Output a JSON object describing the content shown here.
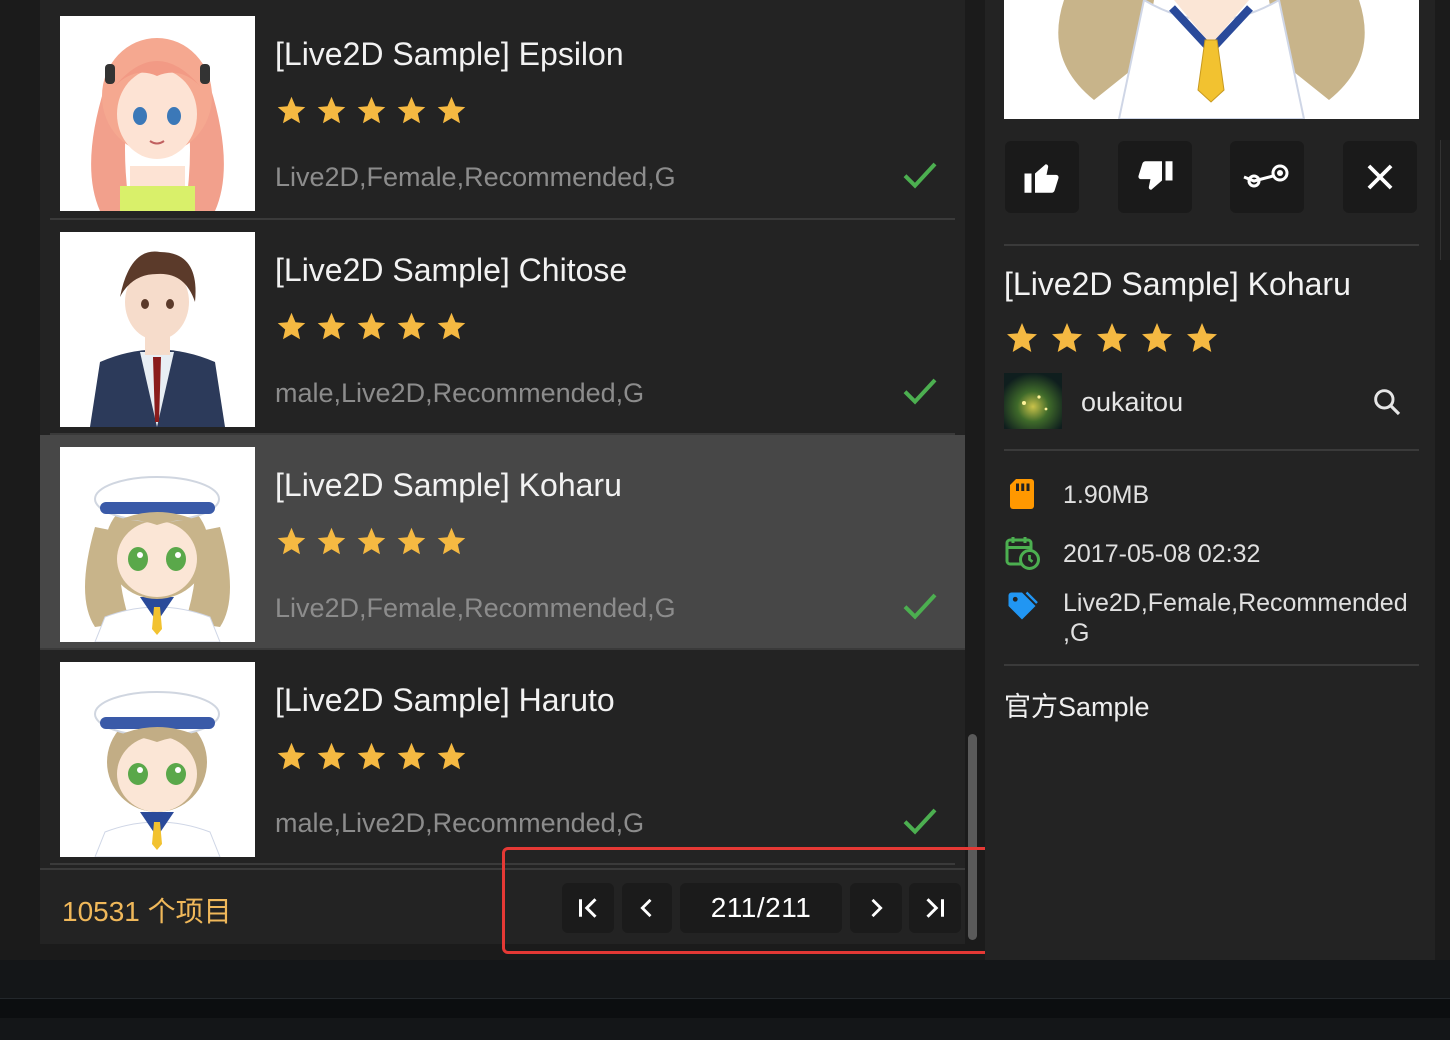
{
  "list": {
    "items": [
      {
        "title": "[Live2D Sample] Epsilon",
        "tags": "Live2D,Female,Recommended,G",
        "rating": 5,
        "selected": false
      },
      {
        "title": "[Live2D Sample] Chitose",
        "tags": "male,Live2D,Recommended,G",
        "rating": 5,
        "selected": false
      },
      {
        "title": "[Live2D Sample] Koharu",
        "tags": "Live2D,Female,Recommended,G",
        "rating": 5,
        "selected": true
      },
      {
        "title": "[Live2D Sample] Haruto",
        "tags": "male,Live2D,Recommended,G",
        "rating": 5,
        "selected": false
      }
    ]
  },
  "footer": {
    "item_count": "10531 个项目",
    "page": "211/211"
  },
  "detail": {
    "title": "[Live2D Sample] Koharu",
    "rating": 5,
    "author": "oukaitou",
    "size": "1.90MB",
    "date": "2017-05-08 02:32",
    "tags_line1": "Live2D,Female,Recommended",
    "tags_line2": ",G",
    "description": "官方Sample"
  },
  "colors": {
    "star": "#f5b942",
    "check": "#4caf50",
    "accent_count": "#f0b85a",
    "size_icon": "#ff9800",
    "date_icon": "#4caf50",
    "tag_icon": "#2196f3",
    "highlight": "#e53935"
  },
  "icons": {
    "like": "thumbs-up-icon",
    "dislike": "thumbs-down-icon",
    "steam": "steam-icon",
    "close": "close-icon",
    "search": "search-icon",
    "size": "sd-card-icon",
    "date": "calendar-clock-icon",
    "tags": "tag-icon",
    "check": "check-icon",
    "first": "first-page-icon",
    "prev": "chevron-left-icon",
    "next": "chevron-right-icon",
    "last": "last-page-icon"
  }
}
